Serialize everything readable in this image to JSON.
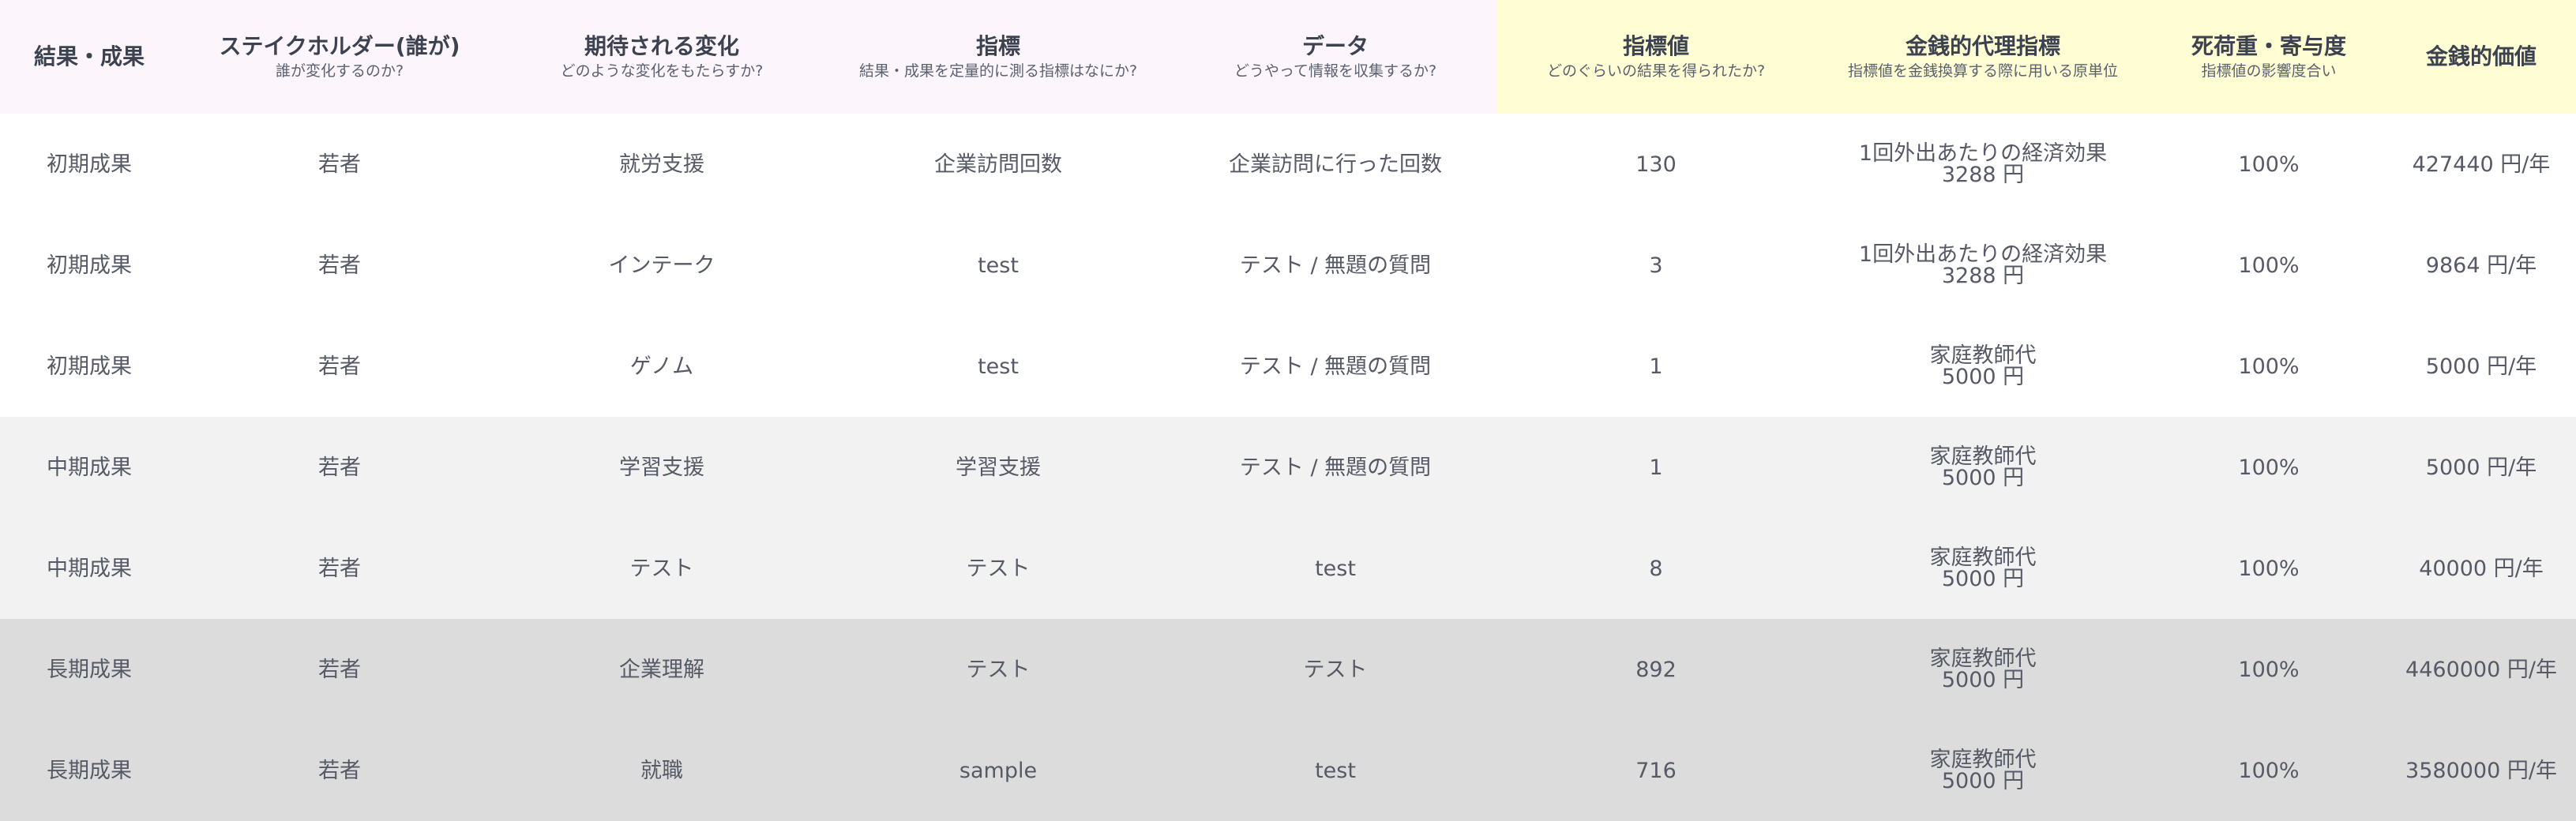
{
  "headers": [
    {
      "title": "結果・成果",
      "subtitle": ""
    },
    {
      "title": "ステイクホルダー(誰が)",
      "subtitle": "誰が変化するのか?"
    },
    {
      "title": "期待される変化",
      "subtitle": "どのような変化をもたらすか?"
    },
    {
      "title": "指標",
      "subtitle": "結果・成果を定量的に測る指標はなにか?"
    },
    {
      "title": "データ",
      "subtitle": "どうやって情報を収集するか?"
    },
    {
      "title": "指標値",
      "subtitle": "どのぐらいの結果を得られたか?"
    },
    {
      "title": "金銭的代理指標",
      "subtitle": "指標値を金銭換算する際に用いる原単位"
    },
    {
      "title": "死荷重・寄与度",
      "subtitle": "指標値の影響度合い"
    },
    {
      "title": "金銭的価値",
      "subtitle": ""
    }
  ],
  "header_colors": {
    "left": "#fcf5fc",
    "right": "#fefdd4"
  },
  "rows": [
    {
      "stage": "初期成果",
      "stakeholder": "若者",
      "change": "就労支援",
      "indicator": "企業訪問回数",
      "data": "企業訪問に行った回数",
      "value": "130",
      "proxy_name": "1回外出あたりの経済効果",
      "proxy_amount": "3288 円",
      "deadweight": "100%",
      "monetary": "427440 円/年"
    },
    {
      "stage": "初期成果",
      "stakeholder": "若者",
      "change": "インテーク",
      "indicator": "test",
      "data": "テスト / 無題の質問",
      "value": "3",
      "proxy_name": "1回外出あたりの経済効果",
      "proxy_amount": "3288 円",
      "deadweight": "100%",
      "monetary": "9864 円/年"
    },
    {
      "stage": "初期成果",
      "stakeholder": "若者",
      "change": "ゲノム",
      "indicator": "test",
      "data": "テスト / 無題の質問",
      "value": "1",
      "proxy_name": "家庭教師代",
      "proxy_amount": "5000 円",
      "deadweight": "100%",
      "monetary": "5000 円/年"
    },
    {
      "stage": "中期成果",
      "stakeholder": "若者",
      "change": "学習支援",
      "indicator": "学習支援",
      "data": "テスト / 無題の質問",
      "value": "1",
      "proxy_name": "家庭教師代",
      "proxy_amount": "5000 円",
      "deadweight": "100%",
      "monetary": "5000 円/年"
    },
    {
      "stage": "中期成果",
      "stakeholder": "若者",
      "change": "テスト",
      "indicator": "テスト",
      "data": "test",
      "value": "8",
      "proxy_name": "家庭教師代",
      "proxy_amount": "5000 円",
      "deadweight": "100%",
      "monetary": "40000 円/年"
    },
    {
      "stage": "長期成果",
      "stakeholder": "若者",
      "change": "企業理解",
      "indicator": "テスト",
      "data": "テスト",
      "value": "892",
      "proxy_name": "家庭教師代",
      "proxy_amount": "5000 円",
      "deadweight": "100%",
      "monetary": "4460000 円/年"
    },
    {
      "stage": "長期成果",
      "stakeholder": "若者",
      "change": "就職",
      "indicator": "sample",
      "data": "test",
      "value": "716",
      "proxy_name": "家庭教師代",
      "proxy_amount": "5000 円",
      "deadweight": "100%",
      "monetary": "3580000 円/年"
    }
  ],
  "row_colors": {
    "early": "#ffffff",
    "mid": "#f2f2f2",
    "long": "#dcdcdc"
  }
}
